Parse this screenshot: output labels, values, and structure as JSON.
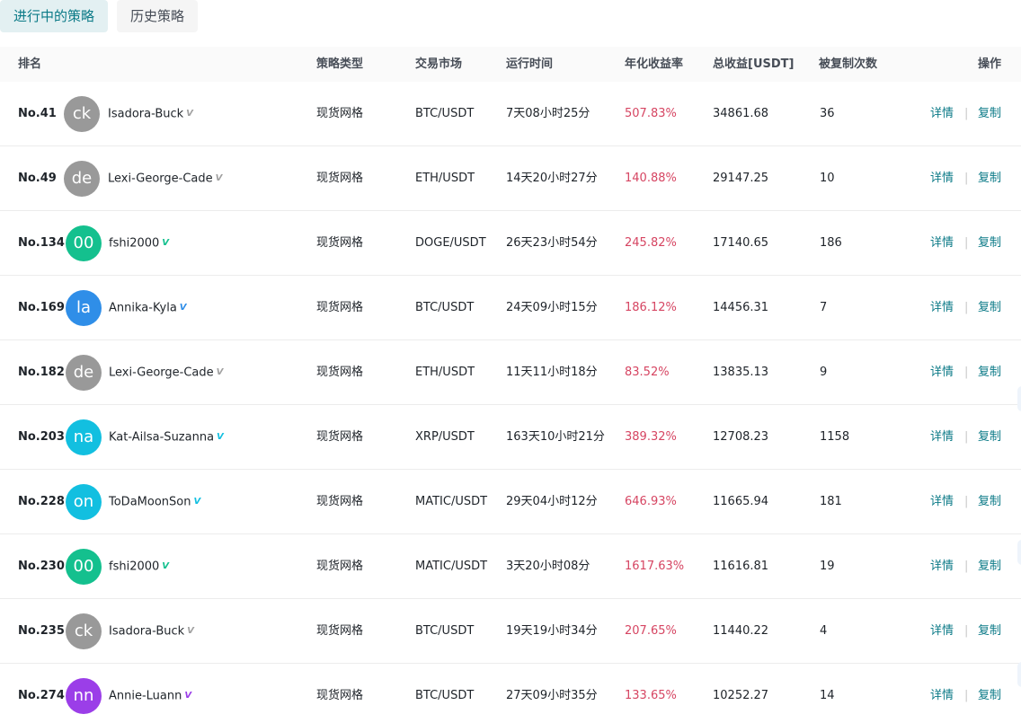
{
  "tabs": [
    {
      "label": "进行中的策略",
      "active": true
    },
    {
      "label": "历史策略",
      "active": false
    }
  ],
  "columns": {
    "rank": "排名",
    "type": "策略类型",
    "market": "交易市场",
    "runtime": "运行时间",
    "apy": "年化收益率",
    "profit": "总收益[USDT]",
    "copies": "被复制次数",
    "actions": "操作"
  },
  "actions": {
    "detail": "详情",
    "separator": "|",
    "copy": "复制"
  },
  "rows": [
    {
      "rank": "No.41",
      "avatar": "ck",
      "avatar_color": "#999999",
      "user": "Isadora-Buck",
      "badge_color": "#a0a0a0",
      "type": "现货网格",
      "market": "BTC/USDT",
      "runtime": "7天08小时25分",
      "apy": "507.83%",
      "profit": "34861.68",
      "copies": "36"
    },
    {
      "rank": "No.49",
      "avatar": "de",
      "avatar_color": "#999999",
      "user": "Lexi-George-Cade",
      "badge_color": "#a0a0a0",
      "type": "现货网格",
      "market": "ETH/USDT",
      "runtime": "14天20小时27分",
      "apy": "140.88%",
      "profit": "29147.25",
      "copies": "10"
    },
    {
      "rank": "No.134",
      "avatar": "00",
      "avatar_color": "#14c08e",
      "user": "fshi2000",
      "badge_color": "#14c08e",
      "type": "现货网格",
      "market": "DOGE/USDT",
      "runtime": "26天23小时54分",
      "apy": "245.82%",
      "profit": "17140.65",
      "copies": "186"
    },
    {
      "rank": "No.169",
      "avatar": "la",
      "avatar_color": "#2f8ee8",
      "user": "Annika-Kyla",
      "badge_color": "#2f8ee8",
      "type": "现货网格",
      "market": "BTC/USDT",
      "runtime": "24天09小时15分",
      "apy": "186.12%",
      "profit": "14456.31",
      "copies": "7"
    },
    {
      "rank": "No.182",
      "avatar": "de",
      "avatar_color": "#999999",
      "user": "Lexi-George-Cade",
      "badge_color": "#a0a0a0",
      "type": "现货网格",
      "market": "ETH/USDT",
      "runtime": "11天11小时18分",
      "apy": "83.52%",
      "profit": "13835.13",
      "copies": "9"
    },
    {
      "rank": "No.203",
      "avatar": "na",
      "avatar_color": "#12bfe0",
      "user": "Kat-Ailsa-Suzanna",
      "badge_color": "#12bfe0",
      "type": "现货网格",
      "market": "XRP/USDT",
      "runtime": "163天10小时21分",
      "apy": "389.32%",
      "profit": "12708.23",
      "copies": "1158"
    },
    {
      "rank": "No.228",
      "avatar": "on",
      "avatar_color": "#12bfe0",
      "user": "ToDaMoonSon",
      "badge_color": "#12bfe0",
      "type": "现货网格",
      "market": "MATIC/USDT",
      "runtime": "29天04小时12分",
      "apy": "646.93%",
      "profit": "11665.94",
      "copies": "181"
    },
    {
      "rank": "No.230",
      "avatar": "00",
      "avatar_color": "#14c08e",
      "user": "fshi2000",
      "badge_color": "#14c08e",
      "type": "现货网格",
      "market": "MATIC/USDT",
      "runtime": "3天20小时08分",
      "apy": "1617.63%",
      "profit": "11616.81",
      "copies": "19"
    },
    {
      "rank": "No.235",
      "avatar": "ck",
      "avatar_color": "#999999",
      "user": "Isadora-Buck",
      "badge_color": "#a0a0a0",
      "type": "现货网格",
      "market": "BTC/USDT",
      "runtime": "19天19小时34分",
      "apy": "207.65%",
      "profit": "11440.22",
      "copies": "4"
    },
    {
      "rank": "No.274",
      "avatar": "nn",
      "avatar_color": "#9b3ee8",
      "user": "Annie-Luann",
      "badge_color": "#9b3ee8",
      "type": "现货网格",
      "market": "BTC/USDT",
      "runtime": "27天09小时35分",
      "apy": "133.65%",
      "profit": "10252.27",
      "copies": "14"
    }
  ],
  "badge_icon": "verified-v-icon"
}
